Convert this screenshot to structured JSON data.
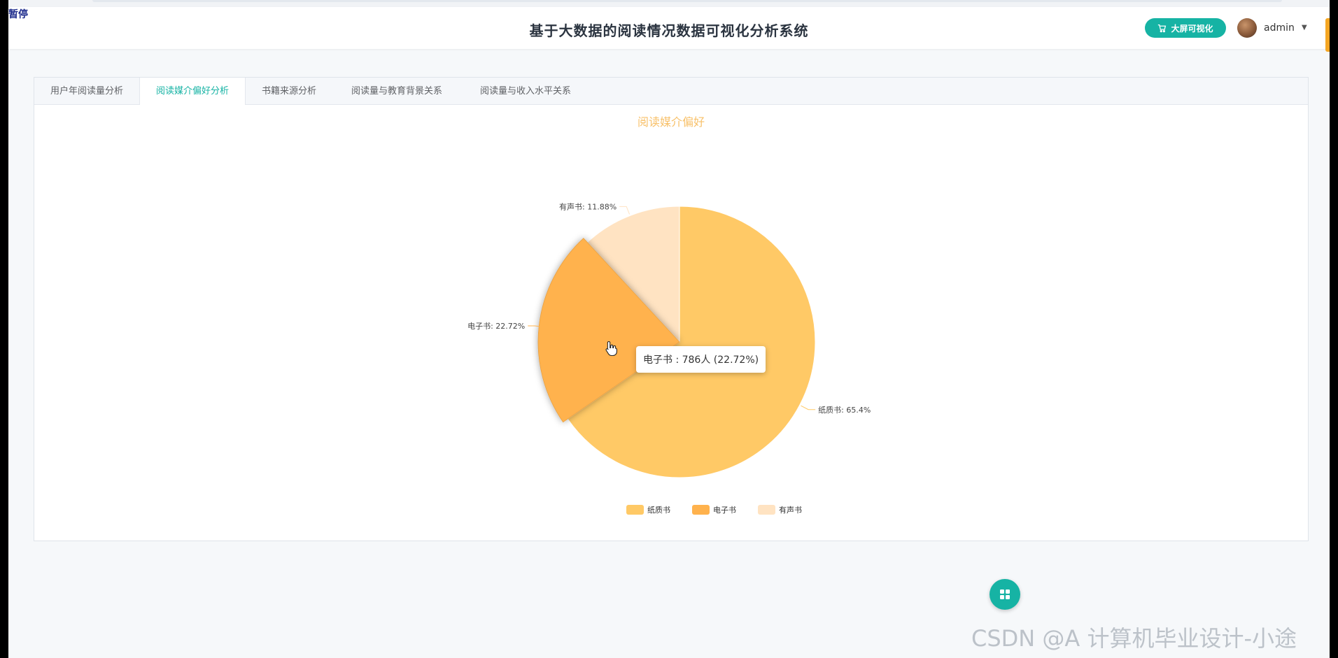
{
  "overlay": {
    "pause_text": "暂停"
  },
  "header": {
    "title": "基于大数据的阅读情况数据可视化分析系统",
    "big_screen_label": "大屏可视化",
    "username": "admin"
  },
  "tabs": [
    {
      "label": "用户年阅读量分析",
      "active": false
    },
    {
      "label": "阅读媒介偏好分析",
      "active": true
    },
    {
      "label": "书籍来源分析",
      "active": false
    },
    {
      "label": "阅读量与教育背景关系",
      "active": false
    },
    {
      "label": "阅读量与收入水平关系",
      "active": false
    }
  ],
  "chart_data": {
    "type": "pie",
    "title": "阅读媒介偏好",
    "categories": [
      "纸质书",
      "电子书",
      "有声书"
    ],
    "values": [
      65.4,
      22.72,
      11.88
    ],
    "unit": "%",
    "colors": [
      "#ffc966",
      "#ffb24d",
      "#ffe3c2"
    ],
    "slice_labels": [
      "纸质书: 65.4%",
      "电子书: 22.72%",
      "有声书: 11.88%"
    ],
    "legend": {
      "position": "bottom",
      "items": [
        "纸质书",
        "电子书",
        "有声书"
      ]
    },
    "highlighted": "电子书",
    "tooltip": {
      "text": "电子书 : 786人 (22.72%)"
    }
  },
  "watermark": "CSDN @A 计算机毕业设计-小途"
}
